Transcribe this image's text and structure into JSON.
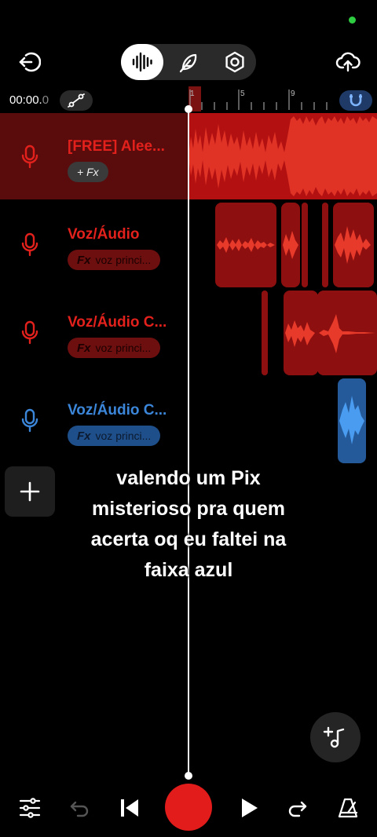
{
  "colors": {
    "accent_red": "#e2211c",
    "track_blue": "#3b86d9",
    "record": "#e21b1b"
  },
  "header": {
    "back_icon": "exit-icon",
    "modes": [
      {
        "icon": "waveform-icon",
        "active": true
      },
      {
        "icon": "feather-icon",
        "active": false
      },
      {
        "icon": "settings-hexagon-icon",
        "active": false
      }
    ],
    "upload_icon": "cloud-upload-icon"
  },
  "timeline": {
    "time_main": "00:00.",
    "time_fraction": "0",
    "ruler_numbers": [
      "1",
      "5",
      "9"
    ]
  },
  "tracks": [
    {
      "name": "[FREE] Alee...",
      "fx_label": "+ Fx",
      "fx_sub": "",
      "color": "red",
      "selected": true
    },
    {
      "name": "Voz/Áudio",
      "fx_label": "Fx",
      "fx_sub": "voz princi...",
      "color": "red",
      "selected": false
    },
    {
      "name": "Voz/Áudio C...",
      "fx_label": "Fx",
      "fx_sub": "voz princi...",
      "color": "red",
      "selected": false
    },
    {
      "name": "Voz/Áudio C...",
      "fx_label": "Fx",
      "fx_sub": "voz princi...",
      "color": "blue",
      "selected": false
    }
  ],
  "caption": {
    "lines": [
      "valendo um Pix",
      "misterioso pra quem",
      "acerta oq eu faltei na",
      "faixa azul"
    ]
  },
  "bottom_bar": {
    "icons": [
      "mixer-sliders-icon",
      "undo-icon",
      "skip-back-icon",
      "record-button",
      "play-icon",
      "redo-icon",
      "metronome-icon"
    ]
  }
}
